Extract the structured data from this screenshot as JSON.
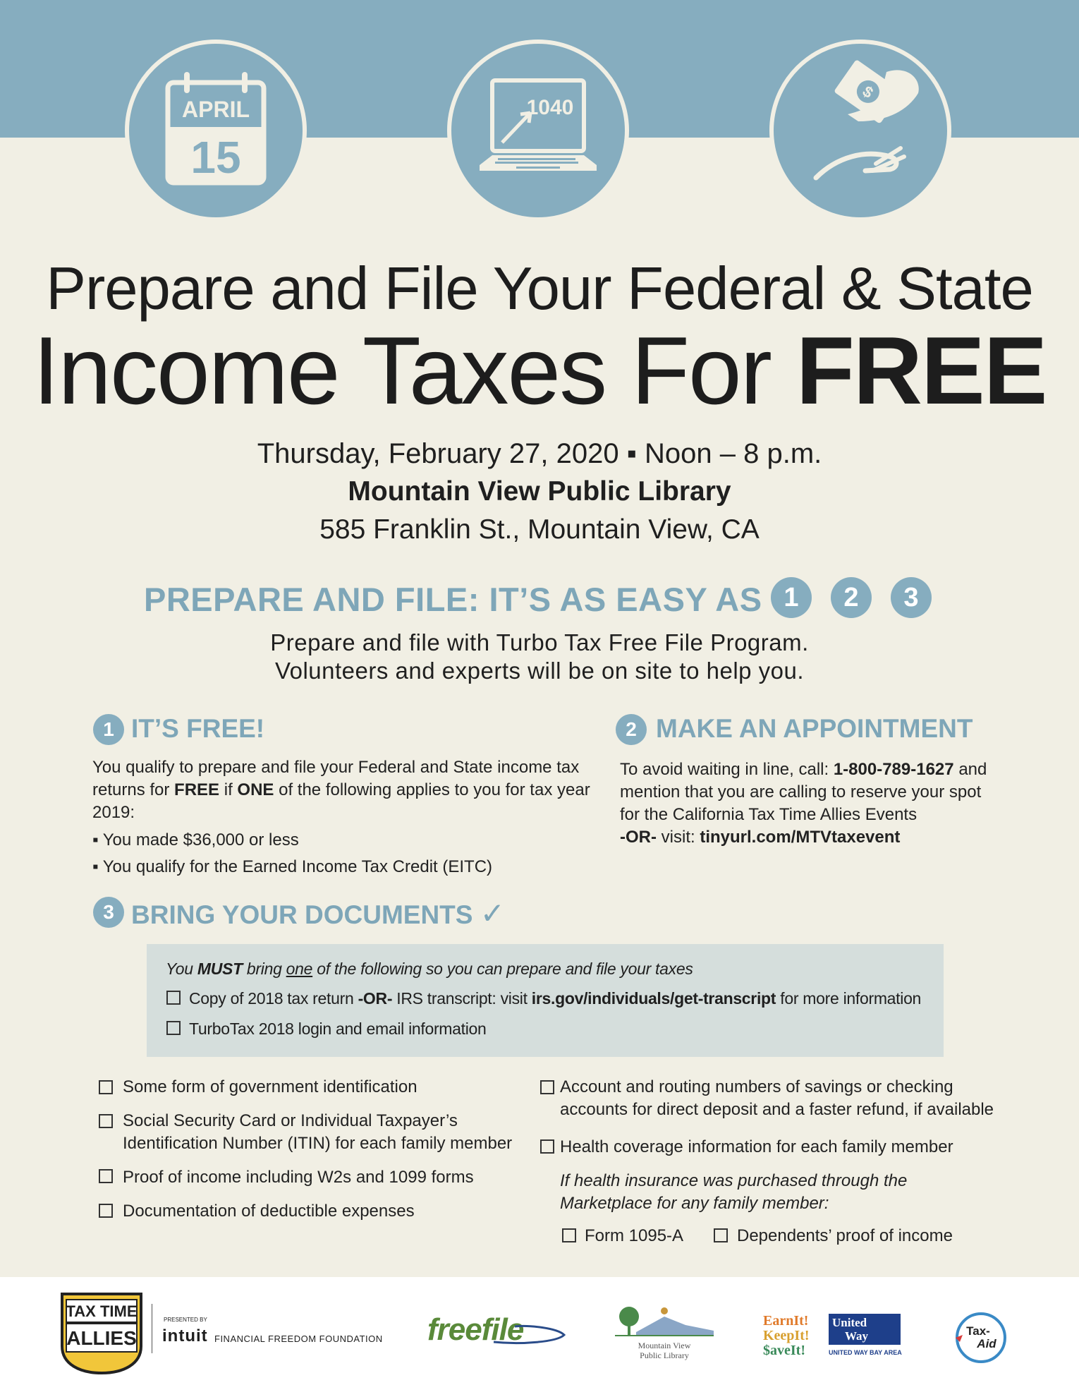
{
  "icons": {
    "calendar": {
      "month": "APRIL",
      "day": "15"
    },
    "laptop": {
      "form": "1040"
    }
  },
  "headline": {
    "line1": "Prepare and File Your Federal & State",
    "line2_prefix": "Income Taxes For",
    "line2_bold": "FREE"
  },
  "event": {
    "date_time": "Thursday, February 27, 2020 ▪ Noon – 8 p.m.",
    "venue": "Mountain View Public Library",
    "address": "585 Franklin St., Mountain View, CA"
  },
  "easy": {
    "heading": "PREPARE AND FILE: IT’S AS EASY AS",
    "steps": [
      "1",
      "2",
      "3"
    ],
    "line1": "Prepare and file with Turbo Tax Free File Program.",
    "line2": "Volunteers and experts will be on site to help you."
  },
  "section1": {
    "num": "1",
    "title": "IT’S FREE!",
    "p_a": "You qualify to prepare and file your Federal and State income tax returns for",
    "p_free": "FREE",
    "p_if": "if",
    "p_one": "ONE",
    "p_b": "of the following applies to you for tax year 2019:",
    "bullets": [
      "You made $36,000 or less",
      "You qualify for the Earned Income Tax Credit (EITC)"
    ]
  },
  "section2": {
    "num": "2",
    "title": "MAKE AN APPOINTMENT",
    "p_a": "To avoid waiting in line, call:",
    "phone": "1-800-789-1627",
    "p_b": "and mention that you are calling to reserve your spot for the California Tax Time Allies Events",
    "or": "-OR-",
    "visit": "visit:",
    "url": "tinyurl.com/MTVtaxevent"
  },
  "section3": {
    "num": "3",
    "title": "BRING YOUR DOCUMENTS",
    "check": "✓",
    "must_you": "You",
    "must_must": "MUST",
    "must_bring": "bring",
    "must_one": "one",
    "must_rest": "of the following so you can prepare and file your taxes",
    "box_item1_a": "Copy of 2018 tax return",
    "box_item1_or": "-OR-",
    "box_item1_b": "IRS transcript: visit",
    "box_item1_url": "irs.gov/individuals/get-transcript",
    "box_item1_c": "for more information",
    "box_item2": "TurboTax 2018 login and email information",
    "left_items": [
      "Some form of government identification",
      "Social Security Card or Individual Taxpayer’s Identification Number (ITIN) for each family member",
      "Proof of income including W2s and 1099 forms",
      "Documentation of deductible expenses"
    ],
    "right_item1": "Account and routing numbers of savings or checking accounts for direct deposit and a faster refund, if available",
    "right_item2": "Health coverage information for each family member",
    "marketplace_note": "If health insurance was purchased through the Marketplace for any family member:",
    "form_1095": "Form 1095-A",
    "dependents": "Dependents’ proof of income"
  },
  "footer": {
    "tta_line1": "TAX TIME",
    "tta_line2": "ALLIES",
    "presented_by": "PRESENTED BY",
    "intuit": "intuit",
    "intuit_foundation": "FINANCIAL FREEDOM FOUNDATION",
    "freefile": "freefile",
    "mvpl_line1": "Mountain View",
    "mvpl_line2": "Public Library",
    "earnit1": "EarnIt!",
    "earnit2": "KeepIt!",
    "earnit3": "$aveIt!",
    "uw1": "United",
    "uw2": "Way",
    "uw_caption": "UNITED WAY BAY AREA",
    "taxaid1": "Tax-",
    "taxaid2": "Aid"
  },
  "colors": {
    "accent": "#86adbf",
    "heading_blue": "#7ea6b8",
    "background": "#f1efe4",
    "doc_box": "#d5dedc"
  }
}
